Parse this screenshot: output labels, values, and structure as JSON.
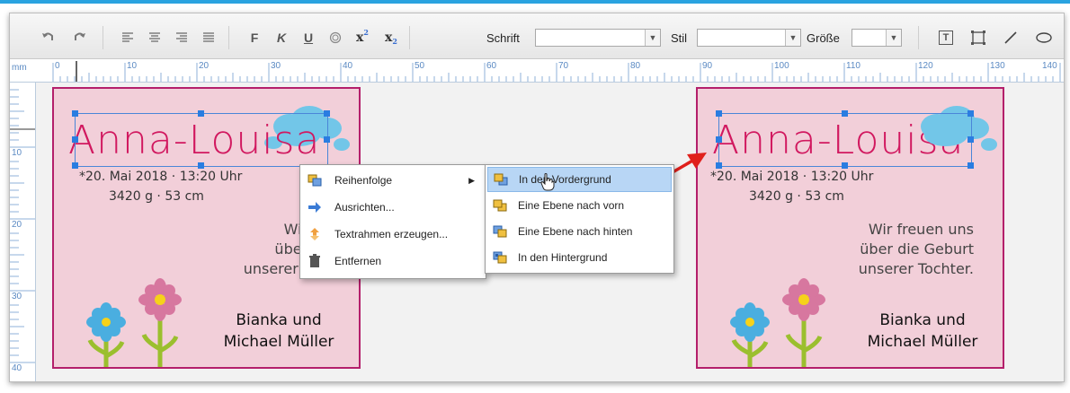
{
  "toolbar": {
    "schrift_label": "Schrift",
    "stil_label": "Stil",
    "groesse_label": "Größe",
    "schrift_value": "",
    "stil_value": "",
    "groesse_value": "",
    "bold_glyph": "F",
    "italic_glyph": "K",
    "underline_glyph": "U",
    "superscript_glyph": "x",
    "superscript_mark": "2",
    "subscript_glyph": "x",
    "subscript_mark": "2",
    "textframe_glyph": "T"
  },
  "ruler": {
    "unit": "mm",
    "h_ticks": [
      "0",
      "10",
      "20",
      "30",
      "40",
      "50",
      "60",
      "70",
      "80",
      "90",
      "100",
      "110",
      "120",
      "130",
      "140"
    ],
    "v_ticks": [
      "10",
      "20",
      "30",
      "40"
    ]
  },
  "card": {
    "name": "Anna-Louisa",
    "birth": "*20. Mai 2018 · 13:20 Uhr",
    "weight": "3420 g · 53 cm",
    "message_lines": [
      "Wir freuen uns",
      "über die Geburt",
      "unserer Tochter."
    ],
    "message_visible_left": [
      "Wir freuen",
      "über die Ge",
      "unserer Tochter."
    ],
    "parents_line1": "Bianka und",
    "parents_line2": "Michael Müller"
  },
  "context_menu": {
    "items": [
      {
        "label": "Reihenfolge",
        "icon": "layers-icon",
        "has_submenu": true
      },
      {
        "label": "Ausrichten...",
        "icon": "arrow-right-icon"
      },
      {
        "label": "Textrahmen erzeugen...",
        "icon": "text-frame-icon"
      },
      {
        "label": "Entfernen",
        "icon": "trash-icon"
      }
    ]
  },
  "submenu": {
    "items": [
      {
        "label": "In den Vordergrund",
        "icon": "bring-to-front-icon",
        "highlighted": true
      },
      {
        "label": "Eine Ebene nach vorn",
        "icon": "bring-forward-icon"
      },
      {
        "label": "Eine Ebene nach hinten",
        "icon": "send-backward-icon"
      },
      {
        "label": "In den Hintergrund",
        "icon": "send-to-back-icon"
      }
    ]
  },
  "colors": {
    "card_bg": "#f2cfd9",
    "card_border": "#b41f6b",
    "name_color": "#d1185f",
    "selection": "#2a7de1",
    "highlight": "#b8d6f5",
    "annotation_arrow": "#e0201c"
  }
}
